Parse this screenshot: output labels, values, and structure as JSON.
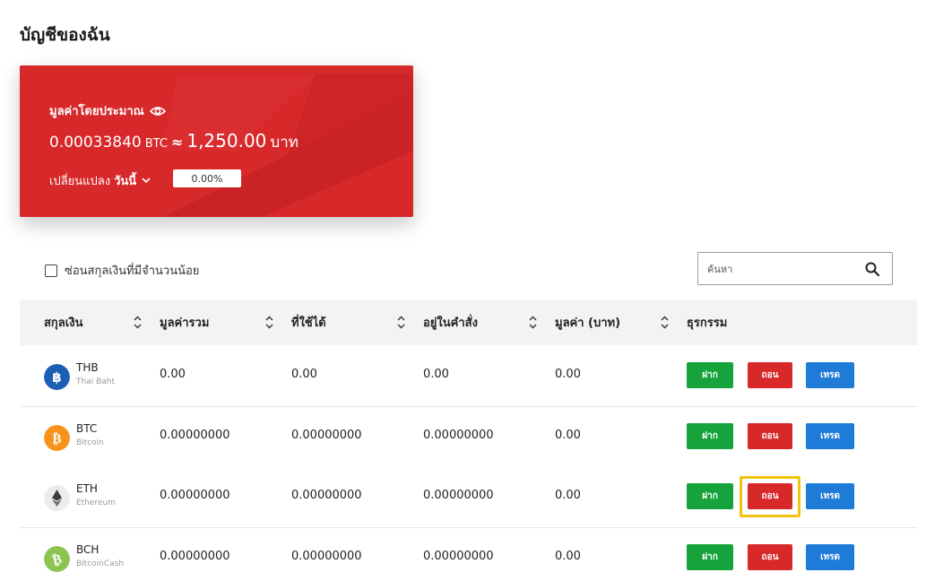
{
  "page": {
    "title": "บัญชีของฉัน"
  },
  "summary": {
    "label": "มูลค่าโดยประมาณ",
    "btc_value": "0.00033840",
    "btc_unit": "BTC",
    "approx": "≈",
    "baht_value": "1,250.00",
    "baht_unit": "บาท",
    "change_label": "เปลี่ยนแปลง",
    "period": "วันนี้",
    "change_pct": "0.00%"
  },
  "filter": {
    "hide_small_label": "ซ่อนสกุลเงินที่มีจำนวนน้อย",
    "hide_small_checked": false
  },
  "search": {
    "placeholder": "ค้นหา",
    "value": ""
  },
  "table": {
    "headers": [
      "สกุลเงิน",
      "มูลค่ารวม",
      "ที่ใช้ได้",
      "อยู่ในคำสั่ง",
      "มูลค่า (บาท)",
      "ธุรกรรม"
    ],
    "actions": {
      "deposit": "ฝาก",
      "withdraw": "ถอน",
      "trade": "เทรด"
    },
    "rows": [
      {
        "symbol": "THB",
        "name": "Thai Baht",
        "icon": "thb-coin-icon",
        "color": "#1a5fb4",
        "total": "0.00",
        "available": "0.00",
        "in_order": "0.00",
        "value": "0.00"
      },
      {
        "symbol": "BTC",
        "name": "Bitcoin",
        "icon": "btc-coin-icon",
        "color": "#f7931a",
        "total": "0.00000000",
        "available": "0.00000000",
        "in_order": "0.00000000",
        "value": "0.00"
      },
      {
        "symbol": "ETH",
        "name": "Ethereum",
        "icon": "eth-coin-icon",
        "color": "#ececec",
        "total": "0.00000000",
        "available": "0.00000000",
        "in_order": "0.00000000",
        "value": "0.00"
      },
      {
        "symbol": "BCH",
        "name": "BitcoinCash",
        "icon": "bch-coin-icon",
        "color": "#8dc351",
        "total": "0.00000000",
        "available": "0.00000000",
        "in_order": "0.00000000",
        "value": "0.00"
      }
    ]
  },
  "colors": {
    "brand_red": "#d7282a",
    "deposit_green": "#17a33b",
    "trade_blue": "#1e7bd8",
    "highlight": "#f1c40f"
  }
}
